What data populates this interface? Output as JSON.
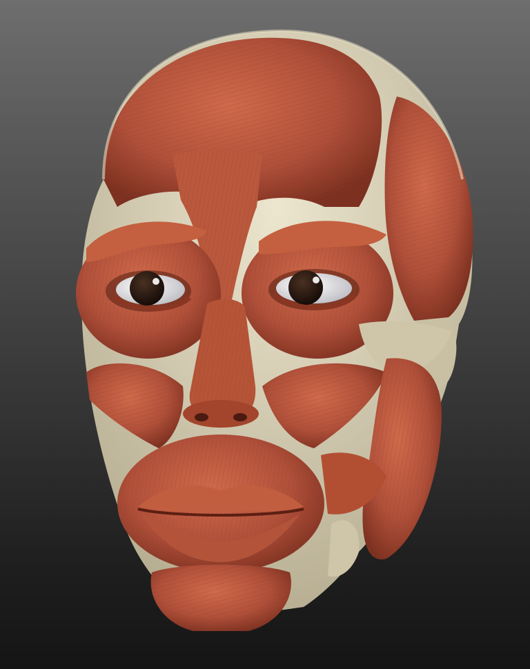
{
  "scene": {
    "subject": "facial-muscle-anatomy-model",
    "colors": {
      "background_top": "#6e6e6e",
      "background_bottom": "#151515",
      "muscle": "#b4553a",
      "muscle_dark": "#7a2f1e",
      "muscle_light": "#d07456",
      "bone": "#d9d2b6",
      "bone_shadow": "#a49c82",
      "eye_white": "#e8e8ea",
      "iris": "#2a1a12"
    }
  }
}
